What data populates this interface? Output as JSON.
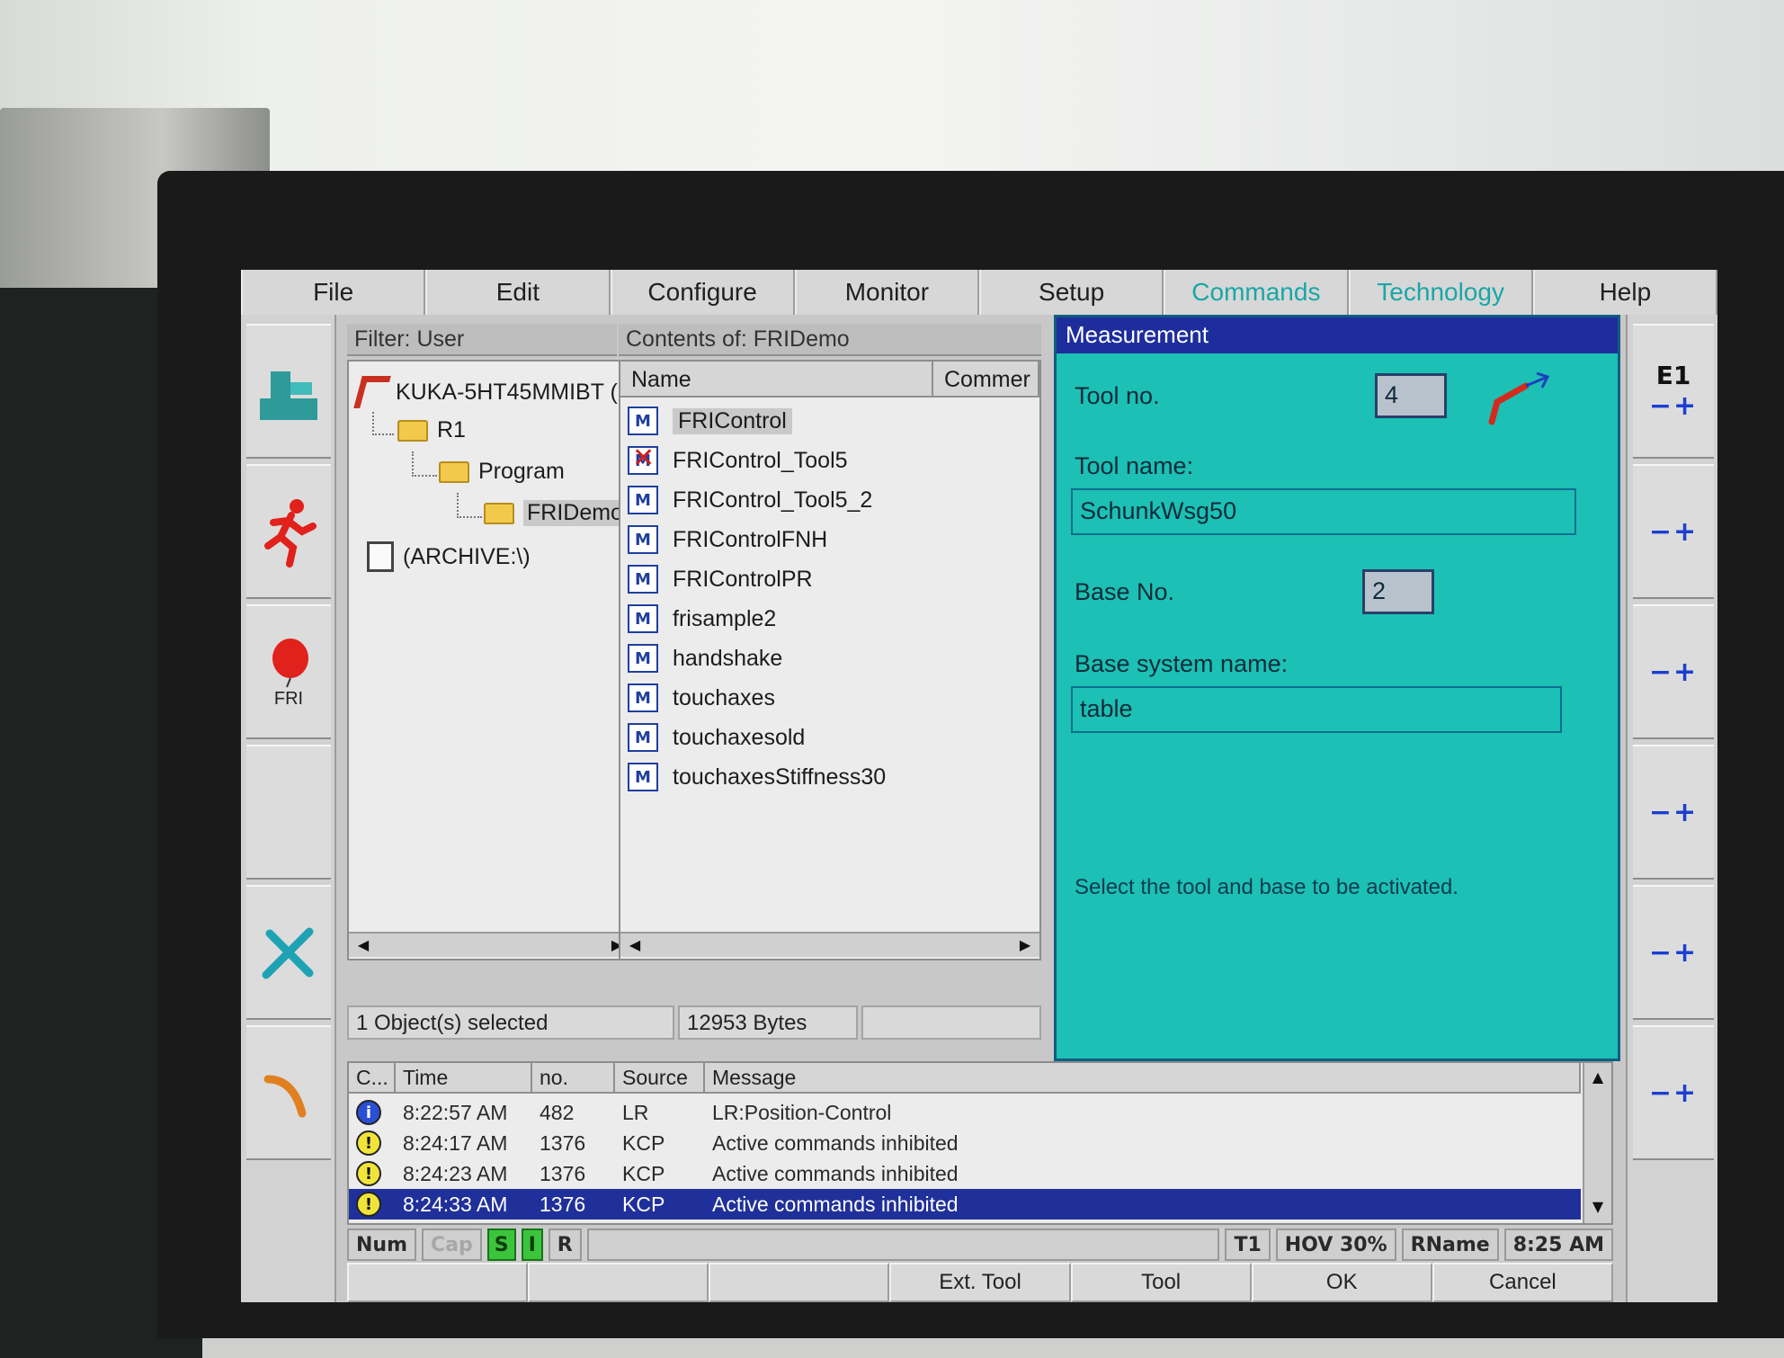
{
  "menubar": {
    "items": [
      {
        "label": "File"
      },
      {
        "label": "Edit"
      },
      {
        "label": "Configure"
      },
      {
        "label": "Monitor"
      },
      {
        "label": "Setup"
      },
      {
        "label": "Commands"
      },
      {
        "label": "Technology"
      },
      {
        "label": "Help"
      }
    ]
  },
  "left_toolbar": {
    "fri_label": "FRI"
  },
  "right_toolbar": {
    "axis_label": "E1",
    "plus_minus": "−+"
  },
  "navigator": {
    "filter_label": "Filter: User",
    "contents_label": "Contents of: FRIDemo",
    "tree": {
      "robot": "KUKA-5HT45MMIBT (",
      "r1": "R1",
      "program": "Program",
      "fridemo": "FRIDemo",
      "archive": "(ARCHIVE:\\)"
    },
    "columns": {
      "name": "Name",
      "comment": "Commer"
    },
    "files": [
      {
        "name": "FRIControl",
        "icon": "program-icon"
      },
      {
        "name": "FRIControl_Tool5",
        "icon": "program-error-icon"
      },
      {
        "name": "FRIControl_Tool5_2",
        "icon": "program-icon"
      },
      {
        "name": "FRIControlFNH",
        "icon": "program-icon"
      },
      {
        "name": "FRIControlPR",
        "icon": "program-icon"
      },
      {
        "name": "frisample2",
        "icon": "program-icon"
      },
      {
        "name": "handshake",
        "icon": "program-icon"
      },
      {
        "name": "touchaxes",
        "icon": "program-icon"
      },
      {
        "name": "touchaxesold",
        "icon": "program-icon"
      },
      {
        "name": "touchaxesStiffness30",
        "icon": "program-icon"
      }
    ],
    "status_selected": "1 Object(s) selected",
    "status_bytes": "12953 Bytes"
  },
  "measurement": {
    "title": "Measurement",
    "tool_no_label": "Tool no.",
    "tool_no_value": "4",
    "tool_name_label": "Tool name:",
    "tool_name_value": "SchunkWsg50",
    "base_no_label": "Base No.",
    "base_no_value": "2",
    "base_name_label": "Base system name:",
    "base_name_value": "table",
    "hint": "Select the tool and base to be activated."
  },
  "messages": {
    "columns": {
      "c": "C...",
      "time": "Time",
      "no": "no.",
      "source": "Source",
      "message": "Message"
    },
    "rows": [
      {
        "type": "info",
        "time": "8:22:57 AM",
        "no": "482",
        "source": "LR",
        "message": "LR:Position-Control"
      },
      {
        "type": "warn",
        "time": "8:24:17 AM",
        "no": "1376",
        "source": "KCP",
        "message": "Active commands inhibited"
      },
      {
        "type": "warn",
        "time": "8:24:23 AM",
        "no": "1376",
        "source": "KCP",
        "message": "Active commands inhibited"
      },
      {
        "type": "warn",
        "time": "8:24:33 AM",
        "no": "1376",
        "source": "KCP",
        "message": "Active commands inhibited"
      }
    ]
  },
  "statusbar": {
    "num": "Num",
    "cap": "Cap",
    "s": "S",
    "i": "I",
    "r": "R",
    "mode": "T1",
    "hov": "HOV 30%",
    "rname": "RName",
    "clock": "8:25 AM"
  },
  "softkeys": [
    {
      "label": ""
    },
    {
      "label": ""
    },
    {
      "label": ""
    },
    {
      "label": "Ext. Tool"
    },
    {
      "label": "Tool"
    },
    {
      "label": "OK"
    },
    {
      "label": "Cancel"
    }
  ],
  "colors": {
    "form_bg": "#1cc0b4",
    "title_bar": "#1e2d9c",
    "selected_row": "#20309a",
    "menu_teal": "#1aa6a6"
  }
}
